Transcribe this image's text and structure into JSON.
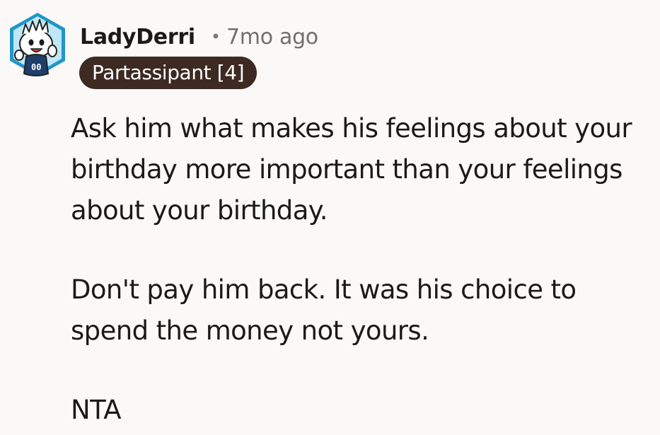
{
  "comment": {
    "author": "LadyDerri",
    "separator": "•",
    "time_ago": "7mo ago",
    "flair": "Partassipant [4]",
    "avatar_badge_text": "00",
    "body_paragraphs": [
      "Ask him what makes his feelings about your birthday more important than your feelings about your birthday.",
      "Don't pay him back. It was his choice to spend the money not yours.",
      "NTA"
    ]
  },
  "colors": {
    "background": "#fbf9f7",
    "text": "#1a1a1b",
    "meta_text": "#6f6f6f",
    "flair_background": "#3d2a22",
    "flair_text": "#ffffff",
    "avatar_frame": "#1f97c7"
  }
}
